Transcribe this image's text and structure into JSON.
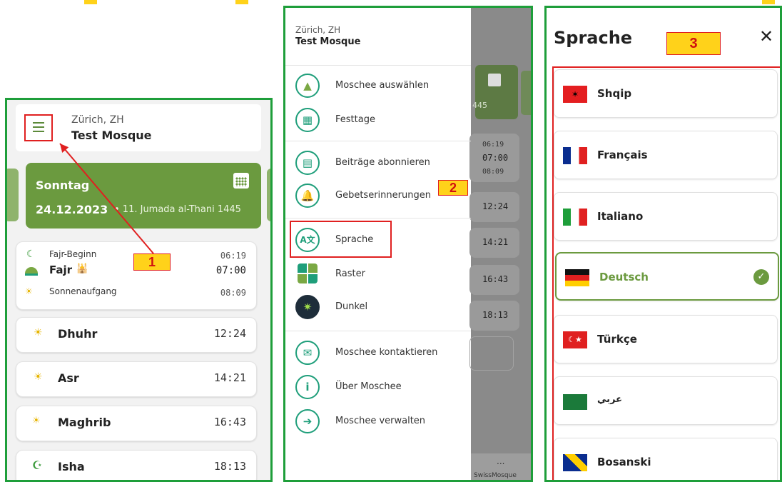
{
  "location": {
    "city": "Zürich, ZH",
    "mosque": "Test Mosque"
  },
  "annotations": {
    "m1": "1",
    "m2": "2",
    "m3": "3"
  },
  "panel1": {
    "day": "Sonntag",
    "date": "24.12.2023",
    "hijri": "• 11. Jumada al-Thani 1445",
    "fajr": {
      "begin_label": "Fajr-Beginn",
      "begin_time": "06:19",
      "name": "Fajr",
      "time": "07:00",
      "sunrise_label": "Sonnenaufgang",
      "sunrise_time": "08:09"
    },
    "prayers": [
      {
        "name": "Dhuhr",
        "time": "12:24"
      },
      {
        "name": "Asr",
        "time": "14:21"
      },
      {
        "name": "Maghrib",
        "time": "16:43"
      },
      {
        "name": "Isha",
        "time": "18:13"
      }
    ]
  },
  "panel2": {
    "menu": [
      {
        "label": "Moschee auswählen"
      },
      {
        "label": "Festtage"
      },
      {
        "label": "Beiträge abonnieren"
      },
      {
        "label": "Gebetserinnerungen"
      },
      {
        "label": "Sprache"
      },
      {
        "label": "Raster"
      },
      {
        "label": "Dunkel"
      },
      {
        "label": "Moschee kontaktieren"
      },
      {
        "label": "Über Moschee"
      },
      {
        "label": "Moschee verwalten"
      }
    ],
    "behind": {
      "date_frag": "445",
      "t1": "06:19",
      "t2": "07:00",
      "t3": "08:09",
      "t4": "12:24",
      "t5": "14:21",
      "t6": "16:43",
      "t7": "18:13",
      "more": "...",
      "brand": "SwissMosque"
    }
  },
  "panel3": {
    "title": "Sprache",
    "close": "✕",
    "languages": [
      {
        "name": "Shqip"
      },
      {
        "name": "Français"
      },
      {
        "name": "Italiano"
      },
      {
        "name": "Deutsch",
        "selected": true
      },
      {
        "name": "Türkçe"
      },
      {
        "name": "عربي"
      },
      {
        "name": "Bosanski"
      }
    ]
  },
  "colors": {
    "green": "#6b9a3f",
    "frame": "#1e9e3a",
    "teal": "#1e9e7a",
    "selected": "#6b9a3f"
  }
}
